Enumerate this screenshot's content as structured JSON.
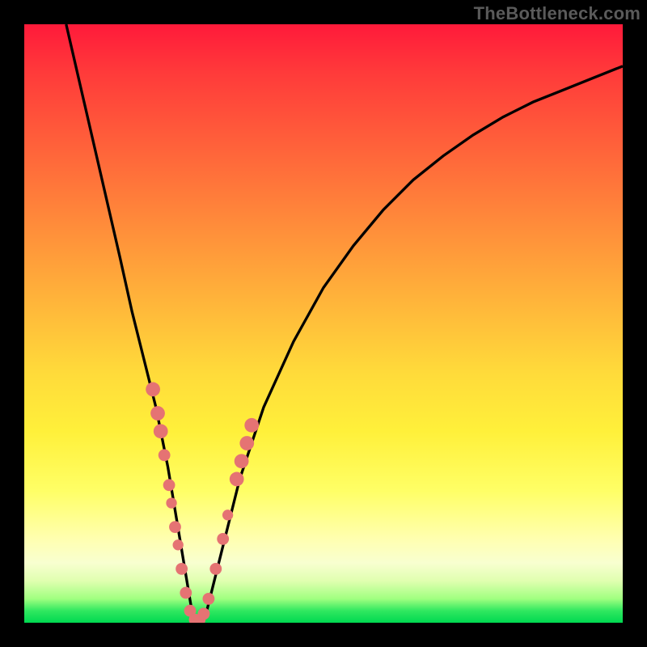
{
  "watermark": "TheBottleneck.com",
  "colors": {
    "background": "#000000",
    "gradient_top": "#ff1a3a",
    "gradient_mid": "#ffda3a",
    "gradient_bottom": "#00d850",
    "curve": "#000000",
    "markers": "#e57373"
  },
  "chart_data": {
    "type": "line",
    "title": "",
    "xlabel": "",
    "ylabel": "",
    "xlim": [
      0,
      100
    ],
    "ylim": [
      0,
      100
    ],
    "series": [
      {
        "name": "curve",
        "x": [
          7,
          10,
          13,
          16,
          18,
          20,
          22,
          24,
          25.5,
          27,
          28,
          29,
          30.5,
          33,
          36,
          40,
          45,
          50,
          55,
          60,
          65,
          70,
          75,
          80,
          85,
          90,
          95,
          100
        ],
        "y": [
          100,
          87,
          74,
          61,
          52,
          44,
          36,
          26,
          17,
          8,
          2,
          0,
          2,
          12,
          24,
          36,
          47,
          56,
          63,
          69,
          74,
          78,
          81.5,
          84.5,
          87,
          89,
          91,
          93
        ]
      }
    ],
    "markers": [
      {
        "x": 21.5,
        "y": 39,
        "r": 1.2
      },
      {
        "x": 22.3,
        "y": 35,
        "r": 1.2
      },
      {
        "x": 22.8,
        "y": 32,
        "r": 1.2
      },
      {
        "x": 23.4,
        "y": 28,
        "r": 1.0
      },
      {
        "x": 24.2,
        "y": 23,
        "r": 1.0
      },
      {
        "x": 24.6,
        "y": 20,
        "r": 0.9
      },
      {
        "x": 25.2,
        "y": 16,
        "r": 1.0
      },
      {
        "x": 25.7,
        "y": 13,
        "r": 0.9
      },
      {
        "x": 26.3,
        "y": 9,
        "r": 1.0
      },
      {
        "x": 27.0,
        "y": 5,
        "r": 1.0
      },
      {
        "x": 27.7,
        "y": 2,
        "r": 1.0
      },
      {
        "x": 28.5,
        "y": 0.5,
        "r": 1.0
      },
      {
        "x": 29.3,
        "y": 0.5,
        "r": 1.0
      },
      {
        "x": 30.0,
        "y": 1.5,
        "r": 1.0
      },
      {
        "x": 30.8,
        "y": 4,
        "r": 1.0
      },
      {
        "x": 32.0,
        "y": 9,
        "r": 1.0
      },
      {
        "x": 33.2,
        "y": 14,
        "r": 1.0
      },
      {
        "x": 34.0,
        "y": 18,
        "r": 0.9
      },
      {
        "x": 35.5,
        "y": 24,
        "r": 1.2
      },
      {
        "x": 36.3,
        "y": 27,
        "r": 1.2
      },
      {
        "x": 37.2,
        "y": 30,
        "r": 1.2
      },
      {
        "x": 38.0,
        "y": 33,
        "r": 1.2
      }
    ]
  }
}
